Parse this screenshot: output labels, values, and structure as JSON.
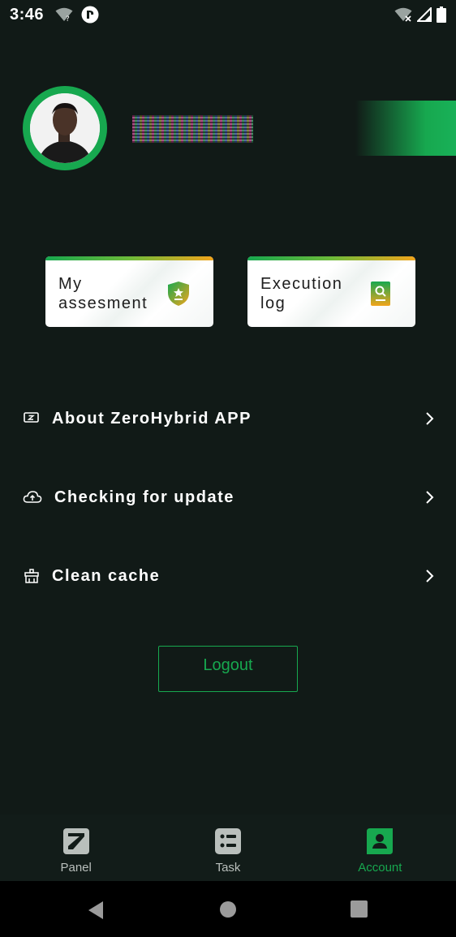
{
  "status_bar": {
    "time": "3:46"
  },
  "profile": {
    "avatar_alt": "user avatar",
    "username_redacted": true
  },
  "cards": [
    {
      "label": "My assesment",
      "icon": "shield-star-icon"
    },
    {
      "label": "Execution log",
      "icon": "search-document-icon"
    }
  ],
  "menu": [
    {
      "label": "About ZeroHybrid APP",
      "icon": "display-z-icon"
    },
    {
      "label": "Checking for update",
      "icon": "cloud-upload-icon"
    },
    {
      "label": "Clean cache",
      "icon": "broom-icon"
    }
  ],
  "logout_label": "Logout",
  "bottom_nav": [
    {
      "label": "Panel",
      "icon": "z-logo-icon",
      "active": false
    },
    {
      "label": "Task",
      "icon": "task-list-icon",
      "active": false
    },
    {
      "label": "Account",
      "icon": "account-card-icon",
      "active": true
    }
  ],
  "colors": {
    "background": "#111a17",
    "accent": "#17a84f",
    "card_bar_end": "#f2a51c"
  }
}
